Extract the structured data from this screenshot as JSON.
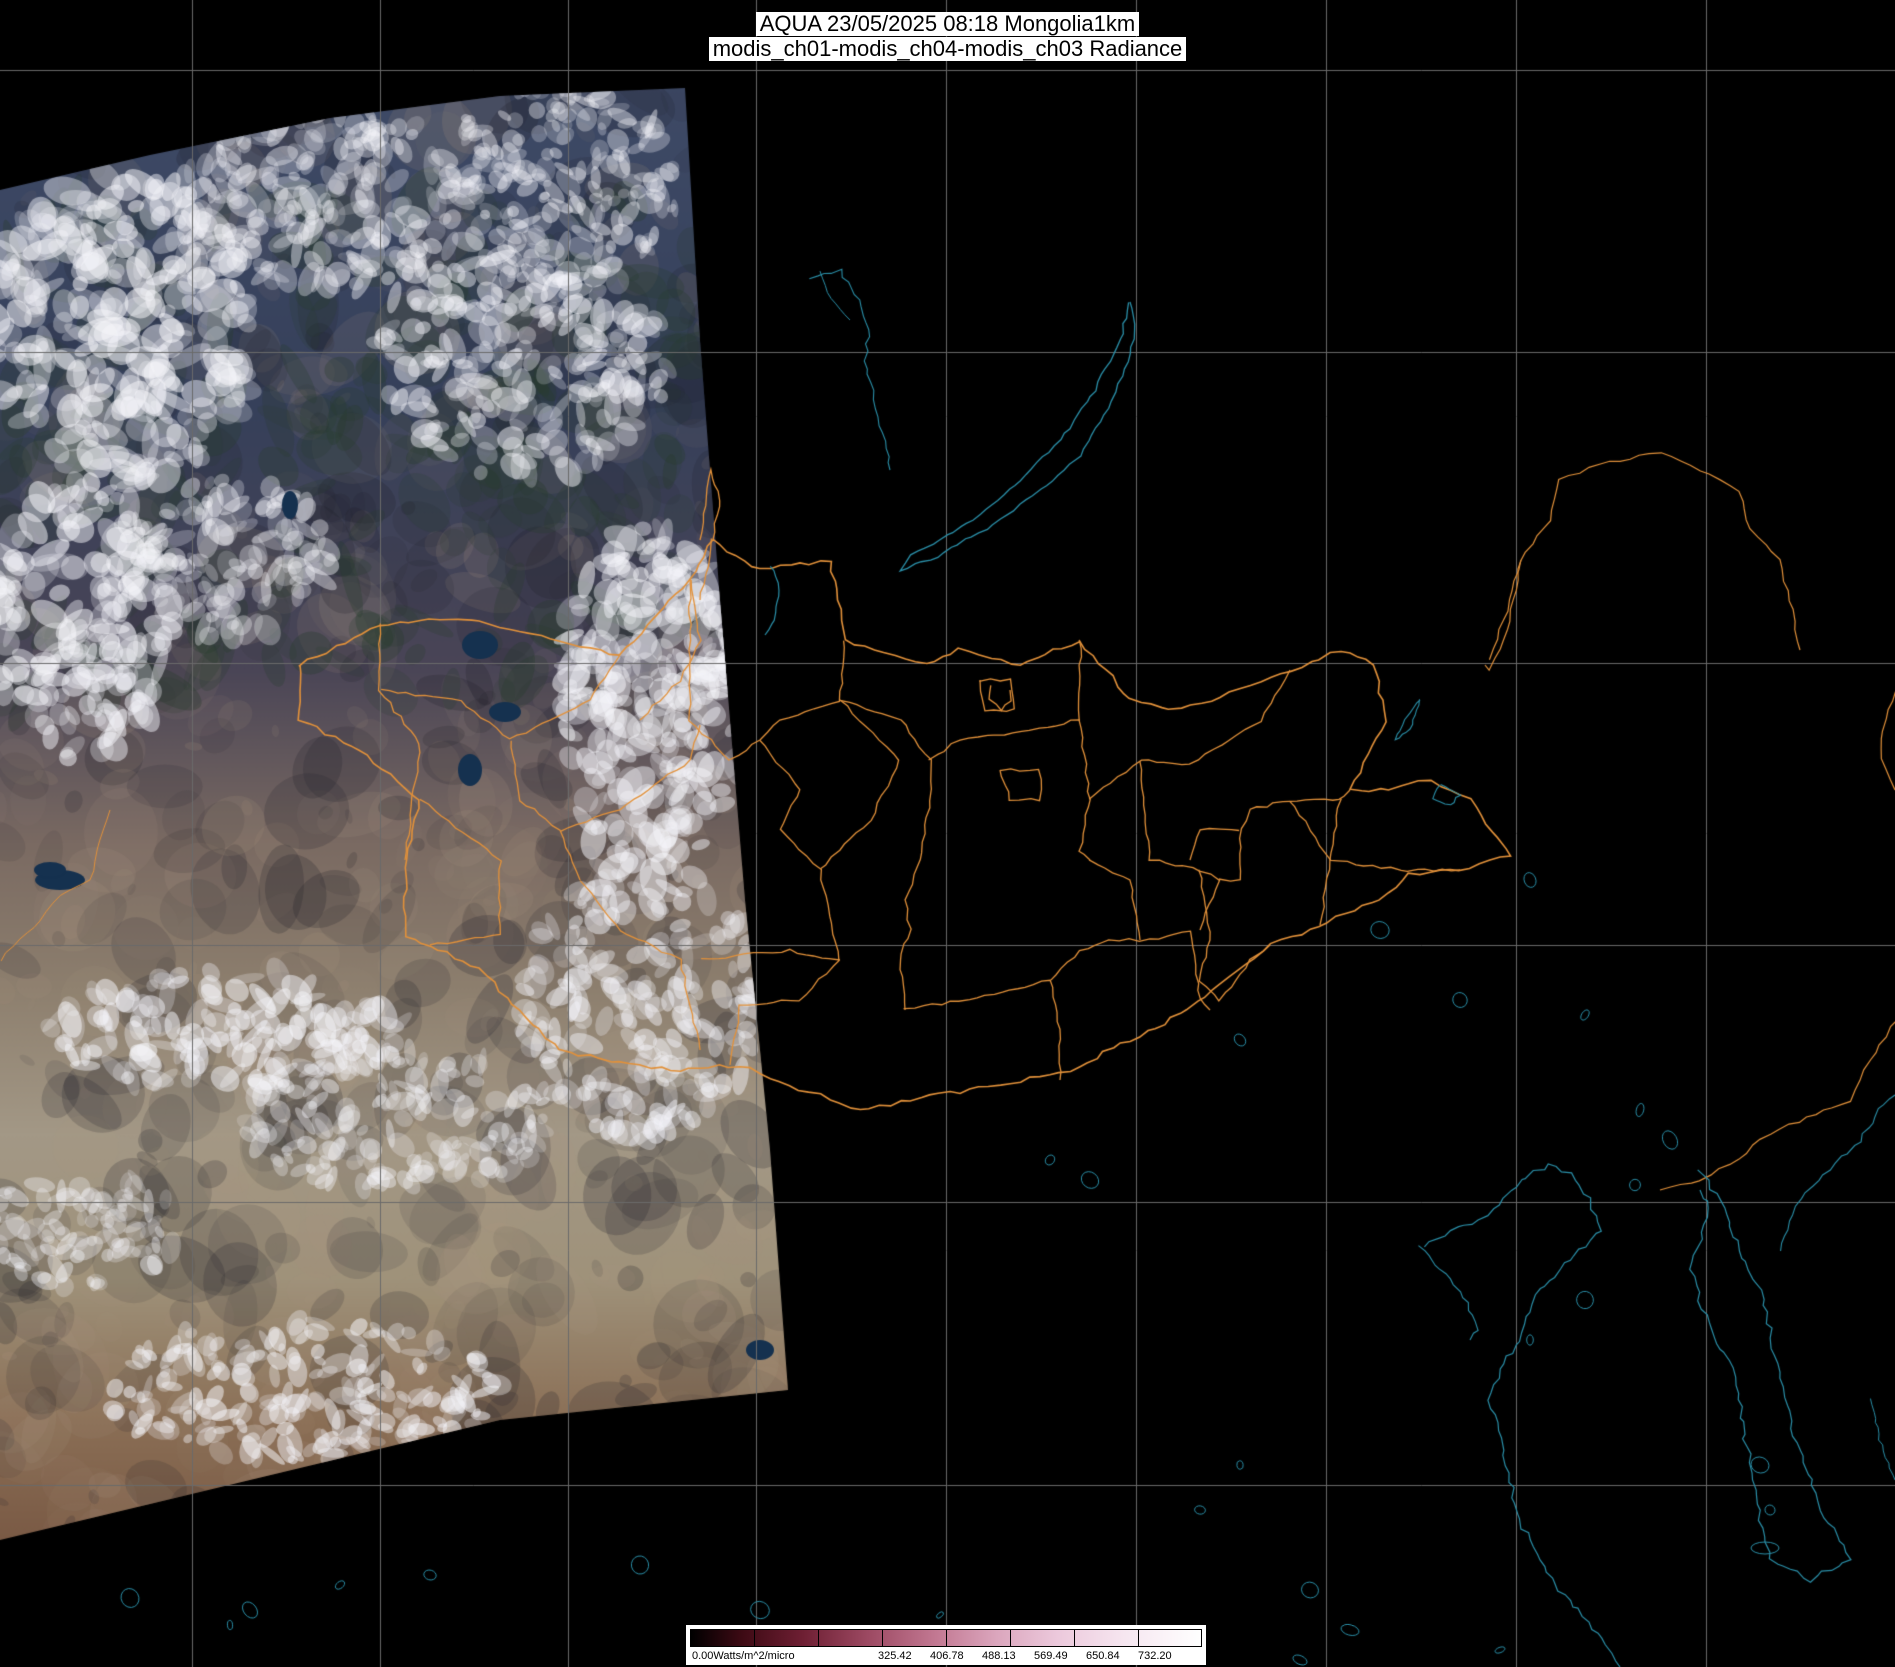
{
  "title": {
    "line1": "AQUA 23/05/2025 08:18 Mongolia1km",
    "line2": "modis_ch01-modis_ch04-modis_ch03 Radiance"
  },
  "legend": {
    "min_label": "0.00Watts/m^2/micro",
    "ticks": [
      "325.42",
      "406.78",
      "488.13",
      "569.49",
      "650.84",
      "732.20"
    ]
  },
  "colors": {
    "background": "#000000",
    "grid": "#6a6a6a",
    "border": "#e2913a",
    "coast": "#2a8fa8",
    "label_bg": "#ffffff"
  }
}
